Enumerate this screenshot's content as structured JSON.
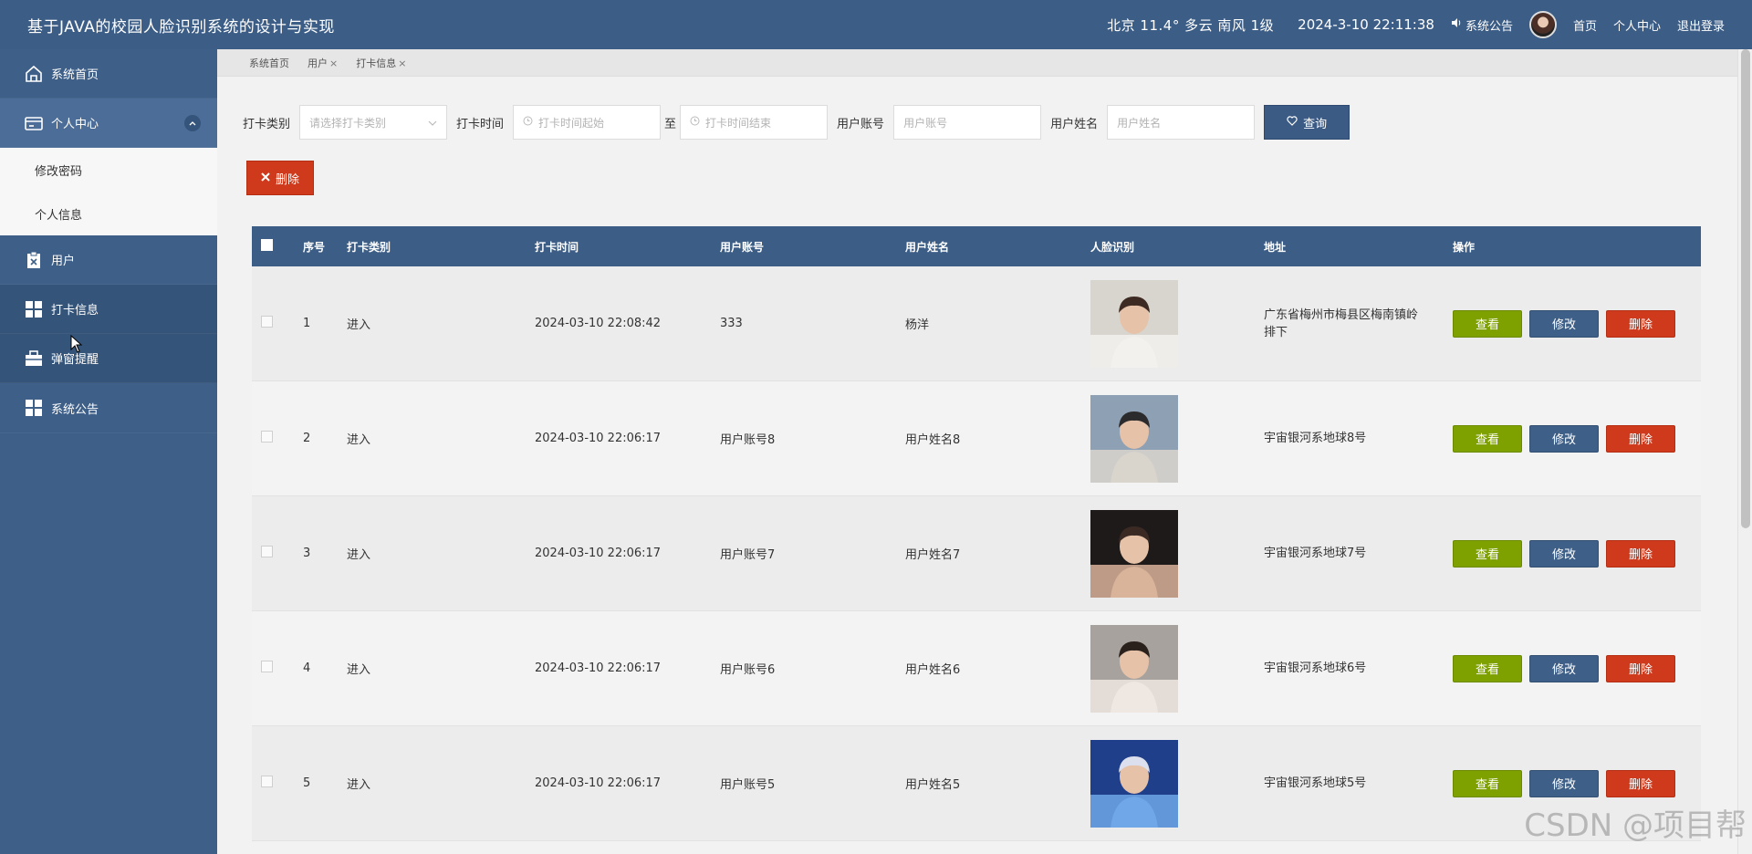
{
  "header": {
    "title": "基于JAVA的校园人脸识别系统的设计与实现",
    "weather": "北京  11.4°  多云  南风  1级",
    "datetime": "2024-3-10 22:11:38",
    "notice": "系统公告",
    "links": {
      "home": "首页",
      "profile": "个人中心",
      "logout": "退出登录"
    }
  },
  "sidebar": {
    "items": [
      {
        "label": "系统首页",
        "icon": "home-icon"
      },
      {
        "label": "个人中心",
        "icon": "wallet-icon"
      },
      {
        "label": "用户",
        "icon": "clipboard-icon"
      },
      {
        "label": "打卡信息",
        "icon": "grid-icon"
      },
      {
        "label": "弹窗提醒",
        "icon": "briefcase-icon"
      },
      {
        "label": "系统公告",
        "icon": "grid-icon"
      }
    ],
    "sub_items": {
      "change_password": "修改密码",
      "personal_info": "个人信息"
    }
  },
  "tabs": [
    {
      "label": "系统首页"
    },
    {
      "label": "用户"
    },
    {
      "label": "打卡信息"
    }
  ],
  "tab_close": "×",
  "filters": {
    "type_label": "打卡类别",
    "type_placeholder": "请选择打卡类别",
    "time_label": "打卡时间",
    "time_start_placeholder": "打卡时间起始",
    "to": "至",
    "time_end_placeholder": "打卡时间结束",
    "account_label": "用户账号",
    "account_placeholder": "用户账号",
    "name_label": "用户姓名",
    "name_placeholder": "用户姓名",
    "query_button": "查询"
  },
  "delete_button": "删除",
  "table": {
    "headers": [
      "序号",
      "打卡类别",
      "打卡时间",
      "用户账号",
      "用户姓名",
      "人脸识别",
      "地址",
      "操作"
    ],
    "rows": [
      {
        "no": "1",
        "type": "进入",
        "time": "2024-03-10 22:08:42",
        "account": "333",
        "name": "杨洋",
        "address": "广东省梅州市梅县区梅南镇岭排下",
        "face_colors": [
          "#d8d5cf",
          "#f3f1ee",
          "#3d2a22"
        ]
      },
      {
        "no": "2",
        "type": "进入",
        "time": "2024-03-10 22:06:17",
        "account": "用户账号8",
        "name": "用户姓名8",
        "address": "宇宙银河系地球8号",
        "face_colors": [
          "#8ea0b4",
          "#d9d5cc",
          "#2b2a2c"
        ]
      },
      {
        "no": "3",
        "type": "进入",
        "time": "2024-03-10 22:06:17",
        "account": "用户账号7",
        "name": "用户姓名7",
        "address": "宇宙银河系地球7号",
        "face_colors": [
          "#1e1a19",
          "#d9b39a",
          "#3b2a24"
        ]
      },
      {
        "no": "4",
        "type": "进入",
        "time": "2024-03-10 22:06:17",
        "account": "用户账号6",
        "name": "用户姓名6",
        "address": "宇宙银河系地球6号",
        "face_colors": [
          "#a7a29d",
          "#efe7e2",
          "#2a201c"
        ]
      },
      {
        "no": "5",
        "type": "进入",
        "time": "2024-03-10 22:06:17",
        "account": "用户账号5",
        "name": "用户姓名5",
        "address": "宇宙银河系地球5号",
        "face_colors": [
          "#1f3f8a",
          "#6fa7e8",
          "#dcdfee"
        ]
      }
    ]
  },
  "ops": {
    "view": "查看",
    "edit": "修改",
    "delete": "删除"
  },
  "watermark": "CSDN @项目帮"
}
